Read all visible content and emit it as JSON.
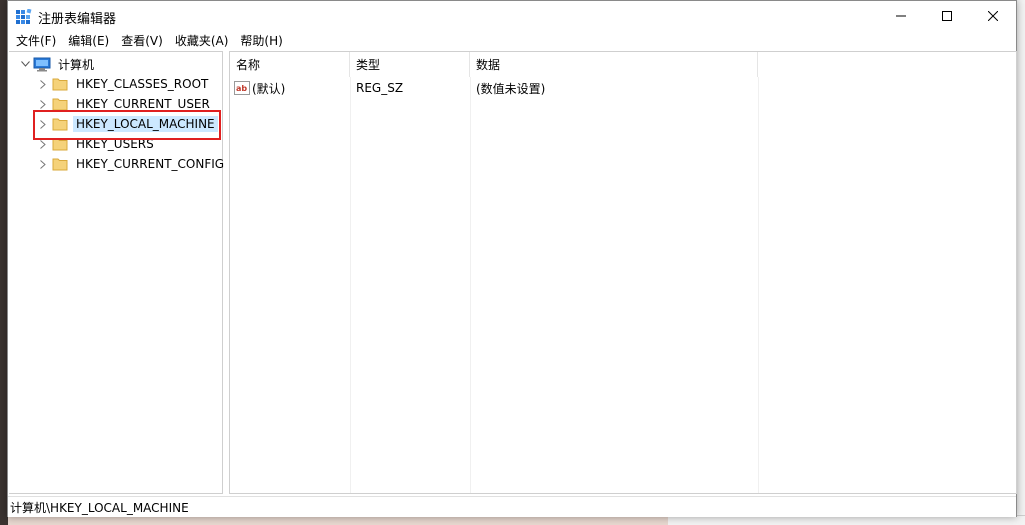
{
  "window": {
    "title": "注册表编辑器"
  },
  "menu": [
    {
      "label": "文件(F)"
    },
    {
      "label": "编辑(E)"
    },
    {
      "label": "查看(V)"
    },
    {
      "label": "收藏夹(A)"
    },
    {
      "label": "帮助(H)"
    }
  ],
  "tree": {
    "root": "计算机",
    "keys": [
      {
        "label": "HKEY_CLASSES_ROOT"
      },
      {
        "label": "HKEY_CURRENT_USER"
      },
      {
        "label": "HKEY_LOCAL_MACHINE"
      },
      {
        "label": "HKEY_USERS"
      },
      {
        "label": "HKEY_CURRENT_CONFIG"
      }
    ],
    "selected_index": 2
  },
  "list": {
    "columns": {
      "name": "名称",
      "type": "类型",
      "data": "数据"
    },
    "rows": [
      {
        "name": "(默认)",
        "type": "REG_SZ",
        "data": "(数值未设置)"
      }
    ]
  },
  "status": {
    "path": "计算机\\HKEY_LOCAL_MACHINE"
  },
  "colors": {
    "selection": "#cce8ff",
    "highlight_box": "#e02020",
    "folder": "#f5d27a",
    "folder_edge": "#d9a93b",
    "ab_icon_red": "#c0392b",
    "computer_icon": "#2a7ad8"
  }
}
